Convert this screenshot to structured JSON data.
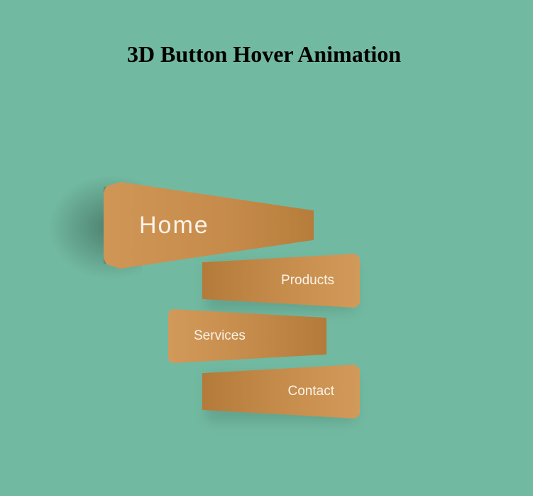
{
  "page": {
    "title": "3D Button Hover Animation",
    "background_color": "#72b9a1"
  },
  "menu": {
    "accent_color": "#c68b4b",
    "text_color": "#fbf3e8",
    "hovered_item": "Home",
    "items": [
      {
        "label": "Home"
      },
      {
        "label": "Products"
      },
      {
        "label": "Services"
      },
      {
        "label": "Contact"
      }
    ]
  }
}
